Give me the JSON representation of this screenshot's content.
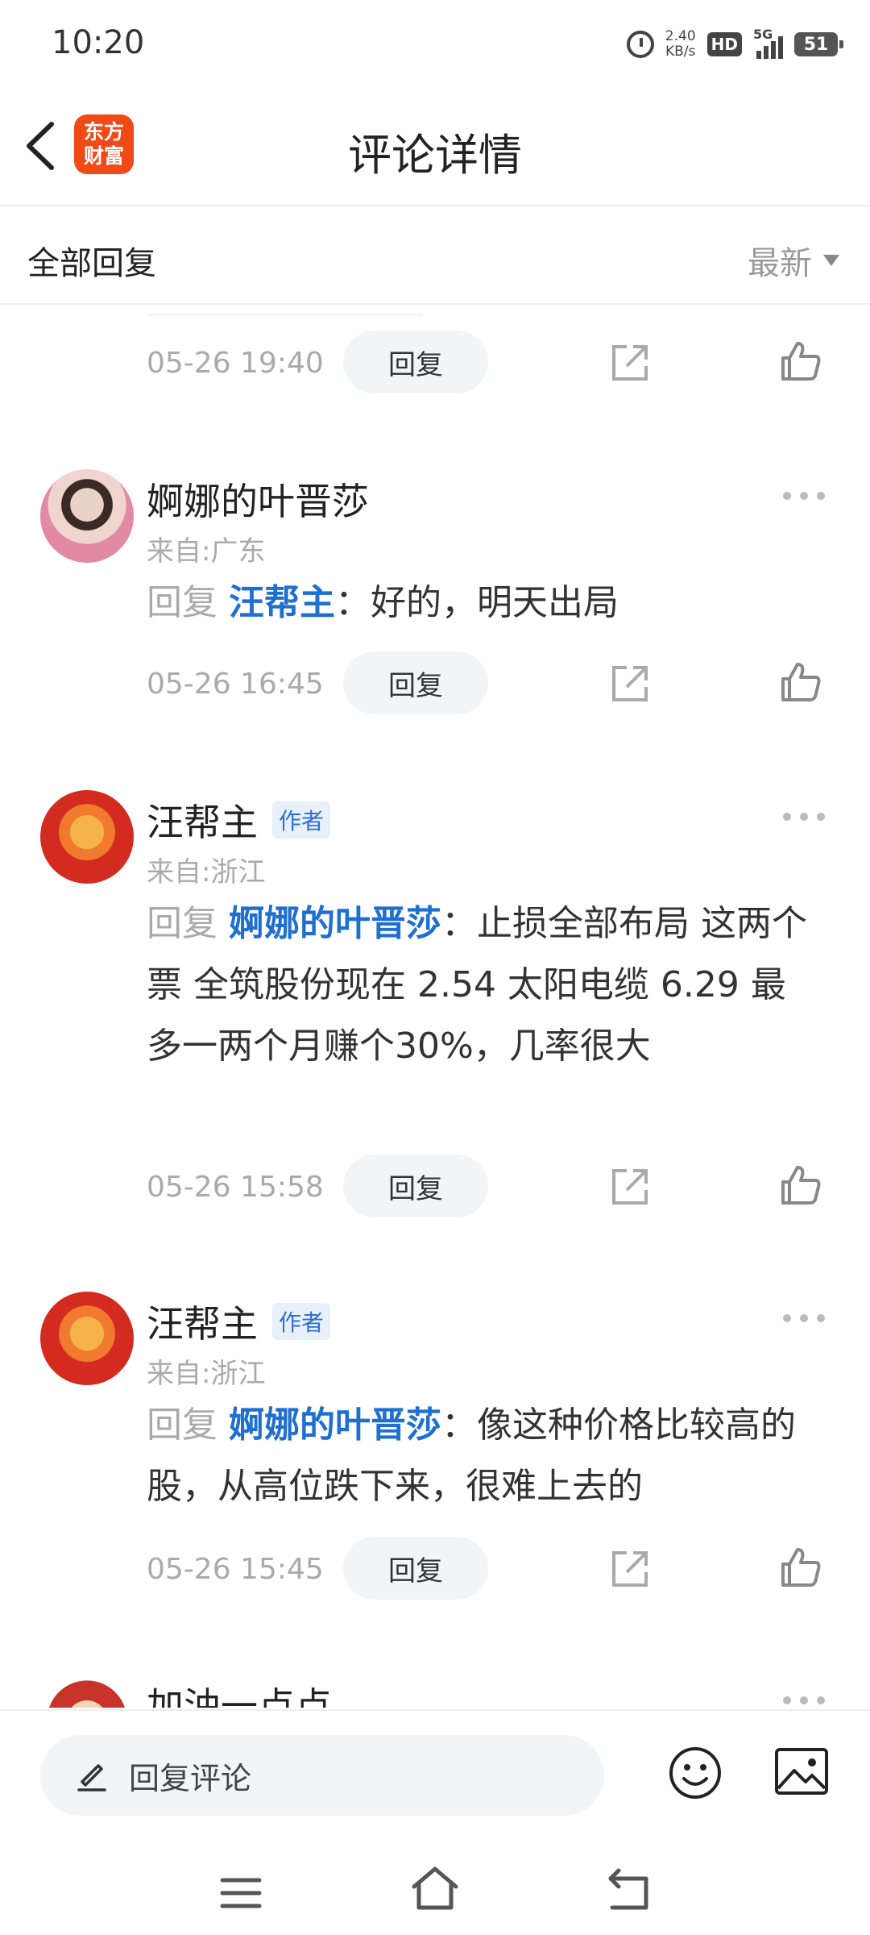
{
  "status_bar": {
    "time": "10:20",
    "net_speed_value": "2.40",
    "net_speed_unit": "KB/s",
    "hd": "HD",
    "network": "5G",
    "battery": "51"
  },
  "header": {
    "logo_line1": "东方",
    "logo_line2": "财富",
    "title": "评论详情"
  },
  "filter": {
    "left_label": "全部回复",
    "sort_label": "最新"
  },
  "reply_button_label": "回复",
  "top_item": {
    "timestamp": "05-26 19:40"
  },
  "comments": [
    {
      "name": "婀娜的叶晋莎",
      "author_tag": "",
      "location": "来自:广东",
      "reply_prefix": "回复",
      "mention": "汪帮主",
      "text": "：好的，明天出局",
      "timestamp": "05-26 16:45"
    },
    {
      "name": "汪帮主",
      "author_tag": "作者",
      "location": "来自:浙江",
      "reply_prefix": "回复",
      "mention": "婀娜的叶晋莎",
      "text": "：止损全部布局 这两个票 全筑股份现在 2.54  太阳电缆 6.29   最多一两个月赚个30%，几率很大",
      "timestamp": "05-26 15:58"
    },
    {
      "name": "汪帮主",
      "author_tag": "作者",
      "location": "来自:浙江",
      "reply_prefix": "回复",
      "mention": "婀娜的叶晋莎",
      "text": "：像这种价格比较高的股，从高位跌下来，很难上去的",
      "timestamp": "05-26 15:45"
    },
    {
      "name": "加油一点点"
    }
  ],
  "bottom_bar": {
    "input_placeholder": "回复评论"
  },
  "icons": {
    "back": "back-arrow-icon",
    "share": "share-icon",
    "like": "thumbs-up-icon",
    "more": "more-dots-icon",
    "edit": "pencil-icon",
    "emoji": "emoji-icon",
    "image": "image-icon"
  }
}
